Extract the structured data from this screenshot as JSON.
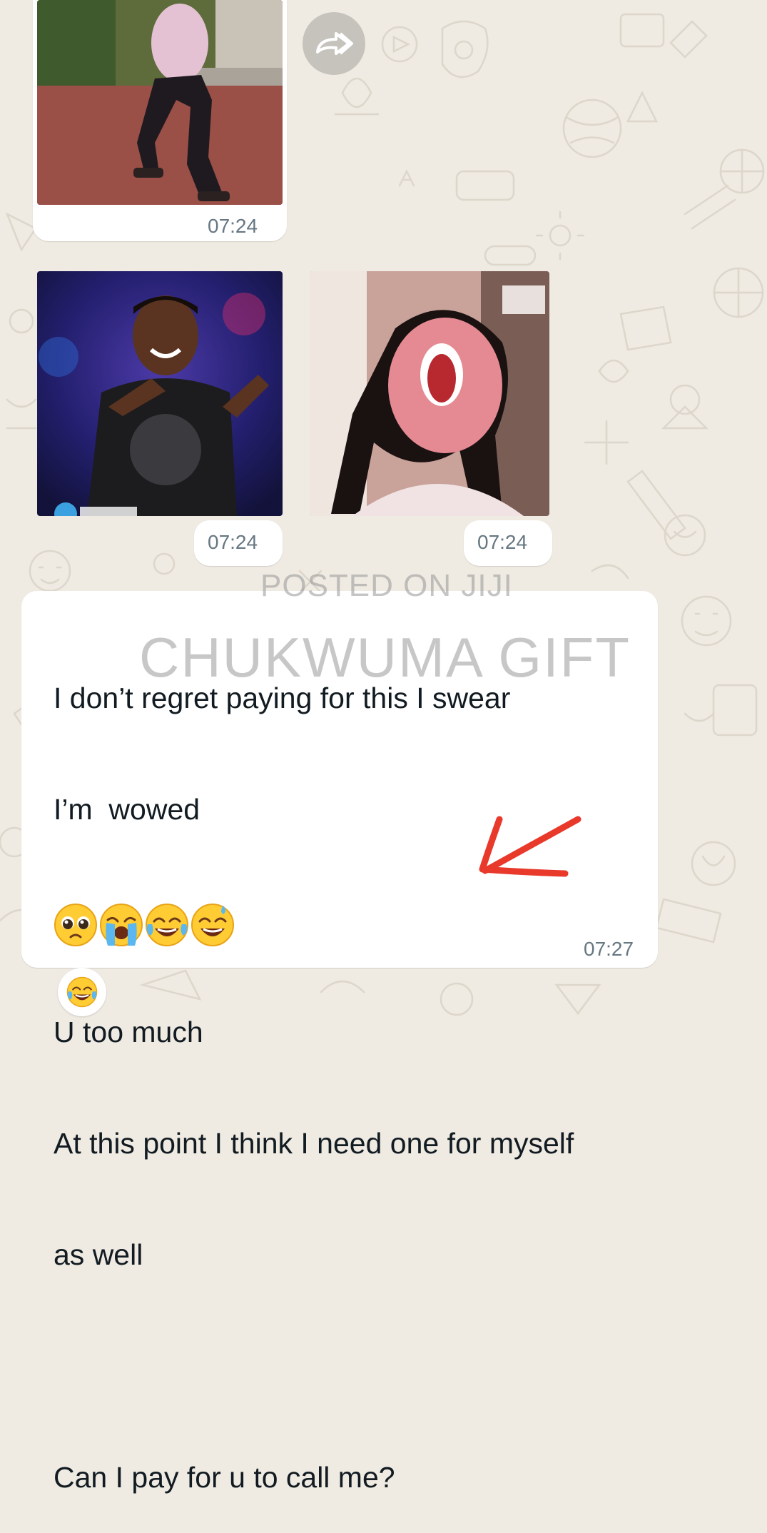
{
  "messages": [
    {
      "kind": "gif",
      "time": "07:24"
    },
    {
      "kind": "gif",
      "time": "07:24"
    },
    {
      "kind": "gif",
      "time": "07:24"
    },
    {
      "kind": "text",
      "lines": [
        "I don’t regret paying for this I swear",
        "I’m  wowed",
        "",
        "U too much",
        "At this point I think I need one for myself",
        "as well",
        "",
        "Can I pay for u to call me?"
      ],
      "emojis": [
        "pleading-face",
        "loudly-crying-face",
        "tears-of-joy-face",
        "grinning-sweat-face"
      ],
      "time": "07:27"
    }
  ],
  "reaction": {
    "emoji": "tears-of-joy-face"
  },
  "watermarks": {
    "line1": "POSTED ON JIJI",
    "line2": "CHUKWUMA GIFT"
  },
  "annotation": {
    "arrow_color": "#e8392b"
  },
  "colors": {
    "background": "#efeae2",
    "bubble": "#ffffff",
    "time": "#667781"
  }
}
